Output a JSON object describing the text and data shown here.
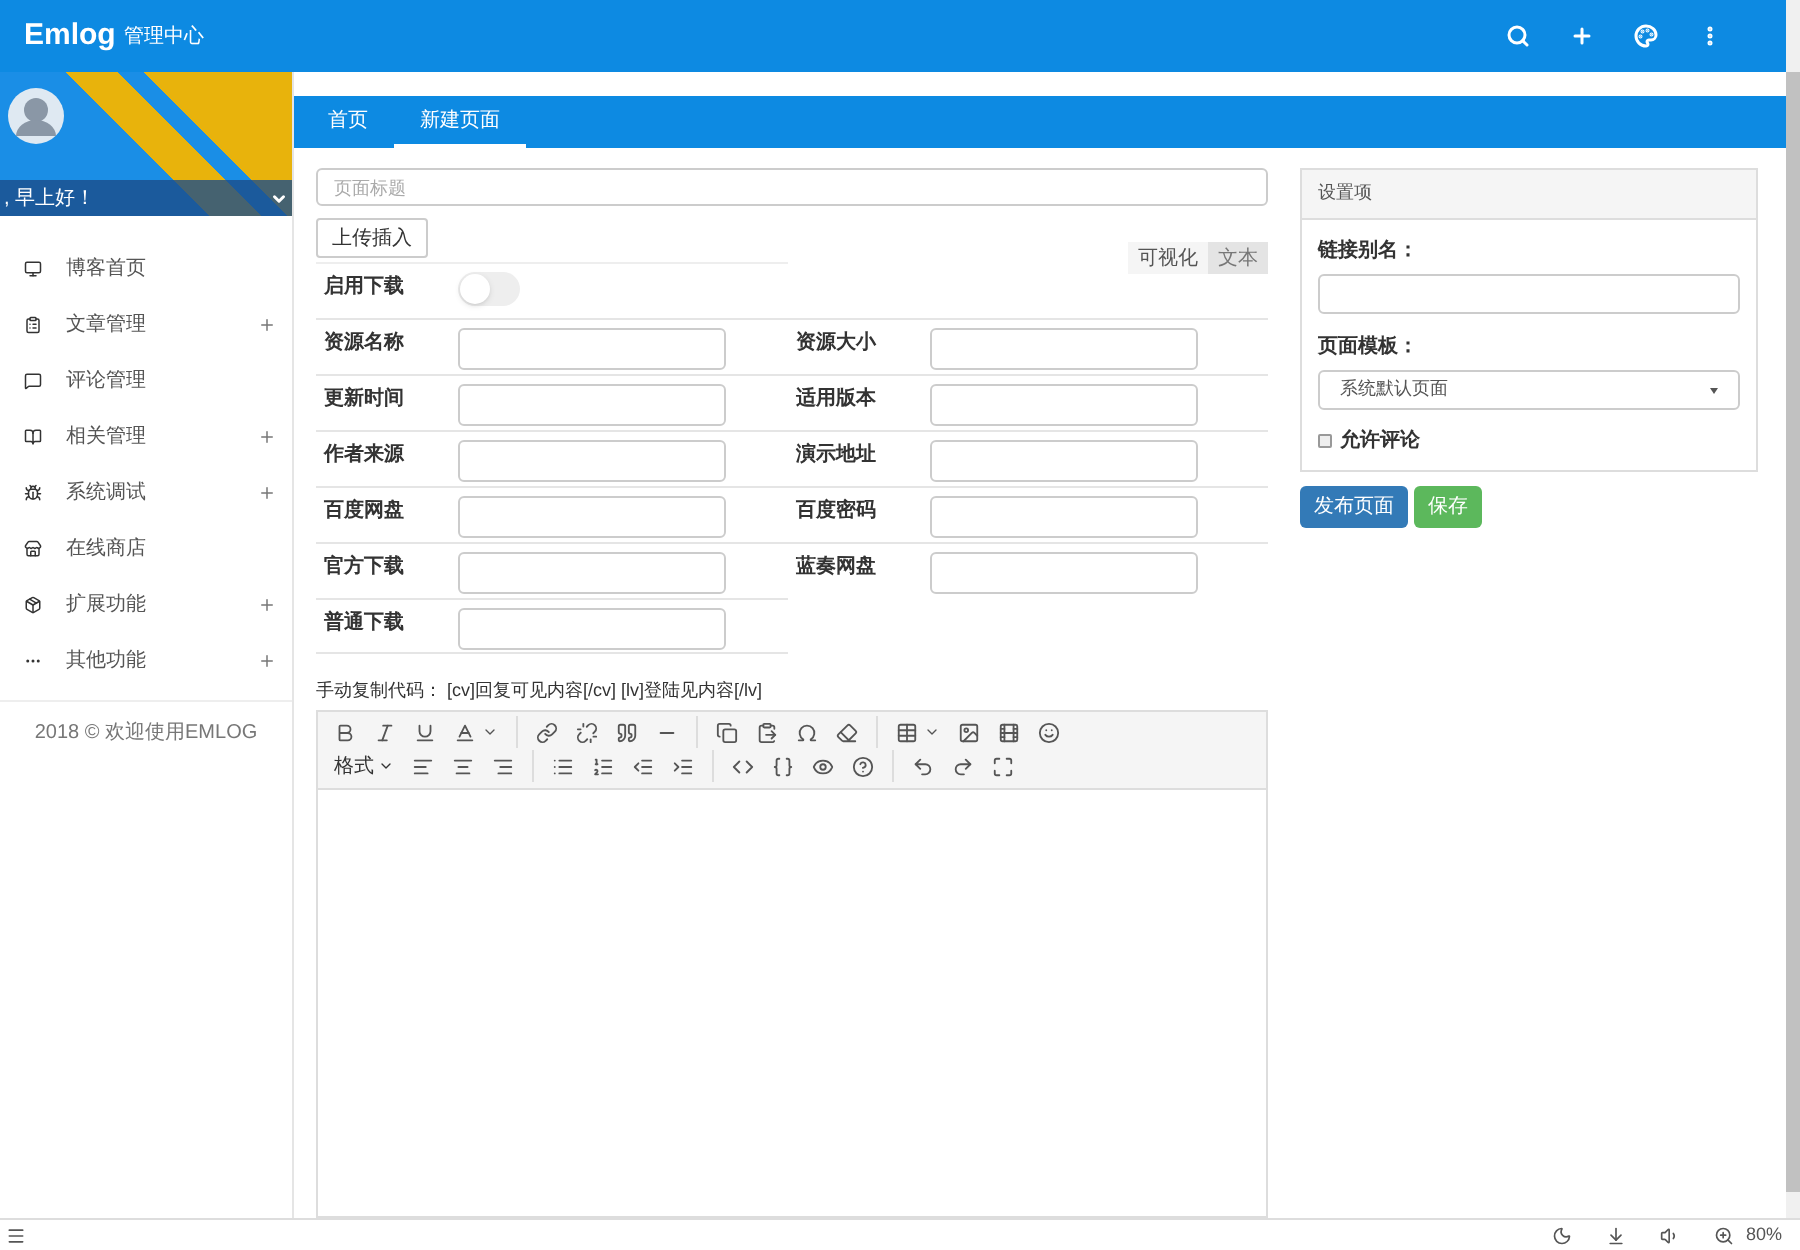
{
  "header": {
    "logo": "Emlog",
    "title": "管理中心"
  },
  "sidebar": {
    "greeting": ", 早上好！",
    "items": [
      {
        "label": "博客首页",
        "expandable": false
      },
      {
        "label": "文章管理",
        "expandable": true
      },
      {
        "label": "评论管理",
        "expandable": false
      },
      {
        "label": "相关管理",
        "expandable": true
      },
      {
        "label": "系统调试",
        "expandable": true
      },
      {
        "label": "在线商店",
        "expandable": false
      },
      {
        "label": "扩展功能",
        "expandable": true
      },
      {
        "label": "其他功能",
        "expandable": true
      }
    ],
    "footer": "2018 © 欢迎使用EMLOG"
  },
  "tabs": [
    {
      "label": "首页",
      "selected": false
    },
    {
      "label": "新建页面",
      "selected": true
    }
  ],
  "form": {
    "title_placeholder": "页面标题",
    "upload_button": "上传插入",
    "editor_modes": [
      {
        "label": "可视化",
        "selected": true
      },
      {
        "label": "文本",
        "selected": false
      }
    ],
    "download_switch": {
      "label": "启用下载",
      "on": false
    },
    "field_rows": [
      [
        {
          "label": "资源名称"
        },
        {
          "label": "资源大小"
        }
      ],
      [
        {
          "label": "更新时间"
        },
        {
          "label": "适用版本"
        }
      ],
      [
        {
          "label": "作者来源"
        },
        {
          "label": "演示地址"
        }
      ],
      [
        {
          "label": "百度网盘"
        },
        {
          "label": "百度密码"
        }
      ],
      [
        {
          "label": "官方下载"
        },
        {
          "label": "蓝奏网盘"
        }
      ],
      [
        {
          "label": "普通下载"
        }
      ]
    ],
    "hint": "手动复制代码： [cv]回复可见内容[/cv] [lv]登陆见内容[/lv]",
    "format_menu": "格式"
  },
  "settings": {
    "title": "设置项",
    "slug_label": "链接别名：",
    "template_label": "页面模板：",
    "template_value": "系统默认页面",
    "allow_comments": {
      "label": "允许评论",
      "checked": false
    }
  },
  "buttons": [
    {
      "label": "发布页面",
      "kind": "primary"
    },
    {
      "label": "保存",
      "kind": "success"
    }
  ],
  "status_bar": {
    "zoom": "80%"
  }
}
